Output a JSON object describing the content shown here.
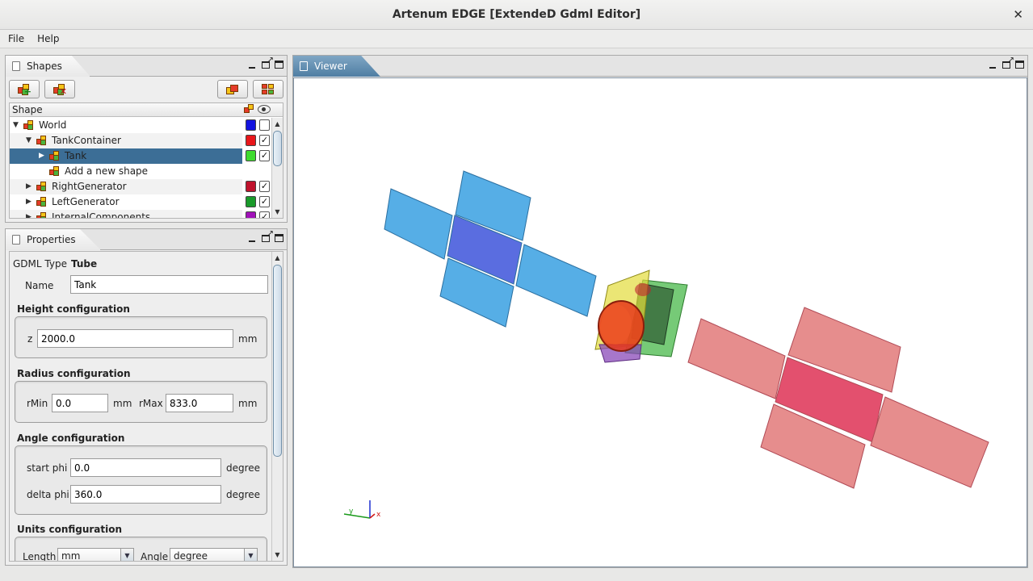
{
  "window": {
    "title": "Artenum EDGE [ExtendeD Gdml Editor]"
  },
  "menu": {
    "items": [
      "File",
      "Help"
    ]
  },
  "shapes_panel": {
    "tab_label": "Shapes",
    "column_header": "Shape",
    "rows": [
      {
        "label": "World",
        "expanded": true,
        "color": "#1414e0",
        "visible": false
      },
      {
        "label": "TankContainer",
        "expanded": true,
        "color": "#e8161a",
        "visible": true
      },
      {
        "label": "Tank",
        "expanded": false,
        "color": "#3fdb2e",
        "visible": true,
        "selected": true
      },
      {
        "label": "Add a new shape"
      },
      {
        "label": "RightGenerator",
        "expanded": false,
        "color": "#c0132d",
        "visible": true
      },
      {
        "label": "LeftGenerator",
        "expanded": false,
        "color": "#1a9a2a",
        "visible": true
      },
      {
        "label": "InternalComponents",
        "expanded": false,
        "color": "#a012b8",
        "visible": true
      }
    ]
  },
  "properties_panel": {
    "tab_label": "Properties",
    "gdml_type_label": "GDML Type",
    "gdml_type_value": "Tube",
    "name_label": "Name",
    "name_value": "Tank",
    "height": {
      "heading": "Height configuration",
      "z_label": "z",
      "z_value": "2000.0",
      "unit": "mm"
    },
    "radius": {
      "heading": "Radius configuration",
      "rmin_label": "rMin",
      "rmin_value": "0.0",
      "rmin_unit": "mm",
      "rmax_label": "rMax",
      "rmax_value": "833.0",
      "rmax_unit": "mm"
    },
    "angle": {
      "heading": "Angle configuration",
      "start_label": "start phi",
      "start_value": "0.0",
      "start_unit": "degree",
      "delta_label": "delta phi",
      "delta_value": "360.0",
      "delta_unit": "degree"
    },
    "units": {
      "heading": "Units configuration",
      "length_label": "Length",
      "length_value": "mm",
      "angle_label": "Angle",
      "angle_value": "degree"
    }
  },
  "viewer_panel": {
    "tab_label": "Viewer",
    "axes": {
      "x": "x",
      "y": "y"
    },
    "colors": {
      "left_panels": "#56aee6",
      "left_center": "#5a6de0",
      "right_panels": "#e68d8d",
      "right_center": "#e3506e",
      "body_yellow": "#e2dc3a",
      "body_green": "#48b84a",
      "tank_red": "#e6371a"
    }
  }
}
